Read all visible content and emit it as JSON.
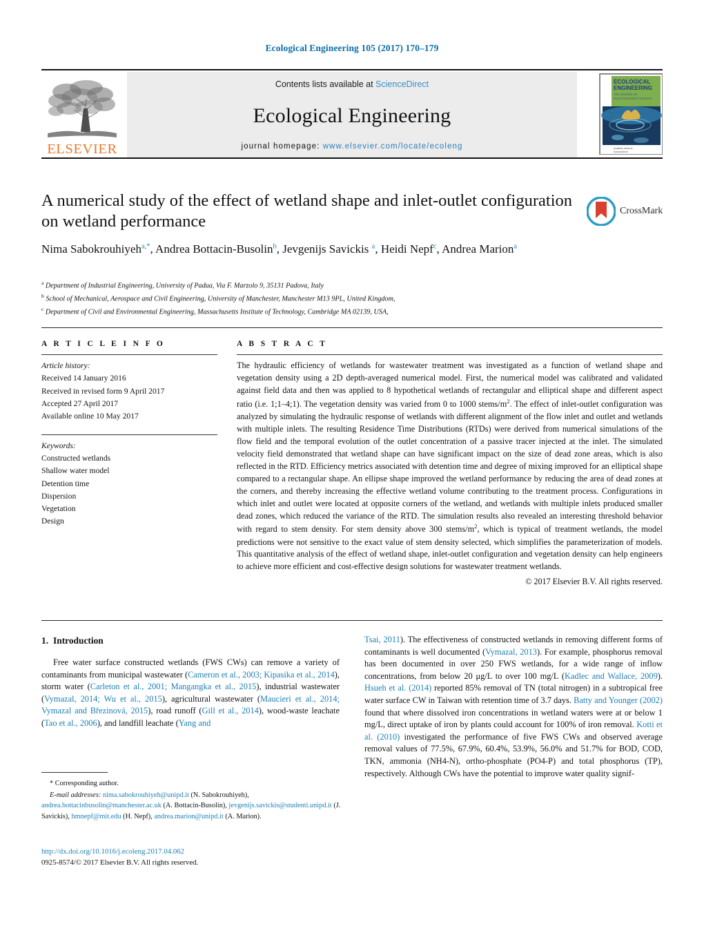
{
  "running_head": "Ecological Engineering 105 (2017) 170–179",
  "masthead": {
    "contents_prefix": "Contents lists available at ",
    "sciencedirect": "ScienceDirect",
    "journal_name": "Ecological Engineering",
    "homepage_prefix": "journal homepage: ",
    "homepage_url": "www.elsevier.com/locate/ecoleng",
    "publisher_wordmark": "ELSEVIER",
    "cover": {
      "line1": "ECOLOGICAL",
      "line2": "ENGINEERING",
      "sub1": "THE JOURNAL OF",
      "sub2": "ECOSYSTEM RESTORATION"
    }
  },
  "article": {
    "title": "A numerical study of the effect of wetland shape and inlet-outlet configuration on wetland performance",
    "authors_html": "Nima Sabokrouhiyeh<sup>a,<span class=\"star\">*</span></sup>, Andrea Bottacin-Busolin<sup>b</sup>, Jevgenijs Savickis <sup>a</sup>, Heidi Nepf<sup>c</sup>, Andrea Marion<sup>a</sup>",
    "crossmark_label": "CrossMark",
    "affiliations": [
      {
        "marker": "a",
        "text": "Department of Industrial Engineering, University of Padua, Via F. Marzolo 9, 35131 Padova, Italy"
      },
      {
        "marker": "b",
        "text": "School of Mechanical, Aerospace and Civil Engineering, University of Manchester, Manchester M13 9PL, United Kingdom,"
      },
      {
        "marker": "c",
        "text": "Department of Civil and Environmental Engineering, Massachusetts Institute of Technology, Cambridge MA 02139, USA,"
      }
    ]
  },
  "article_info": {
    "heading": "A R T I C L E   I N F O",
    "history_label": "Article history:",
    "history": [
      "Received 14 January 2016",
      "Received in revised form 9 April 2017",
      "Accepted 27 April 2017",
      "Available online 10 May 2017"
    ],
    "keywords_label": "Keywords:",
    "keywords": [
      "Constructed wetlands",
      "Shallow water model",
      "Detention time",
      "Dispersion",
      "Vegetation",
      "Design"
    ]
  },
  "abstract": {
    "heading": "A B S T R A C T",
    "body_html": "The hydraulic efficiency of wetlands for wastewater treatment was investigated as a function of wetland shape and vegetation density using a 2D depth-averaged numerical model. First, the numerical model was calibrated and validated against field data and then was applied to 8 hypothetical wetlands of rectangular and elliptical shape and different aspect ratio (i.e. 1;1–4;1). The vegetation density was varied from 0 to 1000 stems/m<sup>2</sup>. The effect of inlet-outlet configuration was analyzed by simulating the hydraulic response of wetlands with different alignment of the flow inlet and outlet and wetlands with multiple inlets. The resulting Residence Time Distributions (RTDs) were derived from numerical simulations of the flow field and the temporal evolution of the outlet concentration of a passive tracer injected at the inlet. The simulated velocity field demonstrated that wetland shape can have significant impact on the size of dead zone areas, which is also reflected in the RTD. Efficiency metrics associated with detention time and degree of mixing improved for an elliptical shape compared to a rectangular shape. An ellipse shape improved the wetland performance by reducing the area of dead zones at the corners, and thereby increasing the effective wetland volume contributing to the treatment process. Configurations in which inlet and outlet were located at opposite corners of the wetland, and wetlands with multiple inlets produced smaller dead zones, which reduced the variance of the RTD. The simulation results also revealed an interesting threshold behavior with regard to stem density. For stem density above 300 stems/m<sup>2</sup>, which is typical of treatment wetlands, the model predictions were not sensitive to the exact value of stem density selected, which simplifies the parameterization of models. This quantitative analysis of the effect of wetland shape, inlet-outlet configuration and vegetation density can help engineers to achieve more efficient and cost-effective design solutions for wastewater treatment wetlands.",
    "copyright": "© 2017 Elsevier B.V. All rights reserved."
  },
  "introduction": {
    "number": "1.",
    "title": "Introduction",
    "left_html": "Free water surface constructed wetlands (FWS CWs) can remove a variety of contaminants from municipal wastewater (<span class=\"lnk\">Cameron et al., 2003; Kipasika et al., 2014</span>), storm water (<span class=\"lnk\">Carleton et al., 2001; Mangangka et al., 2015</span>), industrial wastewater (<span class=\"lnk\">Vymazal, 2014; Wu et al., 2015</span>), agricultural wastewater (<span class=\"lnk\">Maucieri et al., 2014; Vymazal and Březinová, 2015</span>), road runoff (<span class=\"lnk\">Gill et al., 2014</span>), wood-waste leachate (<span class=\"lnk\">Tao et al., 2006</span>), and landfill leachate (<span class=\"lnk\">Yang and</span>",
    "right_html": "<span class=\"lnk\">Tsai, 2011</span>). The effectiveness of constructed wetlands in removing different forms of contaminants is well documented (<span class=\"lnk\">Vymazal, 2013</span>). For example, phosphorus removal has been documented in over 250 FWS wetlands, for a wide range of inflow concentrations, from below 20 μg/L to over 100 mg/L (<span class=\"lnk\">Kadlec and Wallace, 2009</span>). <span class=\"lnk\">Hsueh et al. (2014)</span> reported 85% removal of TN (total nitrogen) in a subtropical free water surface CW in Taiwan with retention time of 3.7 days. <span class=\"lnk\">Batty and Younger (2002)</span> found that where dissolved iron concentrations in wetland waters were at or below 1 mg/L, direct uptake of iron by plants could account for 100% of iron removal. <span class=\"lnk\">Kotti et al. (2010)</span> investigated the performance of five FWS CWs and observed average removal values of 77.5%, 67.9%, 60.4%, 53.9%, 56.0% and 51.7% for BOD, COD, TKN, ammonia (NH4-N), ortho-phosphate (PO4-P) and total phosphorus (TP), respectively. Although CWs have the potential to improve water quality signif-"
  },
  "footnotes": {
    "corresponding": "* Corresponding author.",
    "emails_label": "E-mail addresses:",
    "emails_html": "<span class=\"lnk\">nima.sabokrouhiyeh@unipd.it</span> (N. Sabokrouhiyeh), <span class=\"lnk\">andrea.bottacinbusolin@manchester.ac.uk</span> (A. Bottacin-Busolin), <span class=\"lnk\">jevgenijs.savickis@studenti.unipd.it</span> (J. Savickis), <span class=\"lnk\">hmnepf@mit.edu</span> (H. Nepf), <span class=\"lnk\">andrea.marion@unipd.it</span> (A. Marion)."
  },
  "doi_block": {
    "doi": "http://dx.doi.org/10.1016/j.ecoleng.2017.04.062",
    "issn": "0925-8574/© 2017 Elsevier B.V. All rights reserved."
  },
  "colors": {
    "link_blue": "#1a7fb5",
    "header_blue": "#0b6ea8",
    "sciencedirect_blue": "#3b8fc4",
    "elsevier_orange": "#E8792B",
    "crossmark_ring": "#2e9ec4",
    "crossmark_red": "#d8412f",
    "masthead_gray": "#ececec"
  }
}
